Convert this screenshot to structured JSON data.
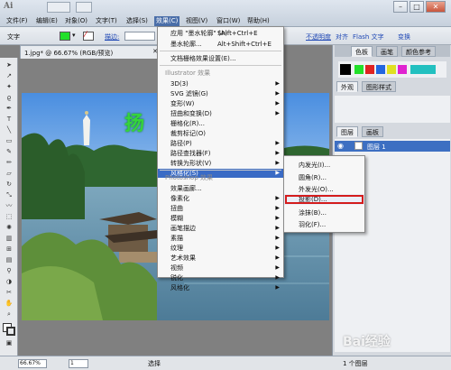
{
  "app": {
    "logo": "Ai"
  },
  "menubar": {
    "items": [
      "文件(F)",
      "编辑(E)",
      "对象(O)",
      "文字(T)",
      "选择(S)",
      "效果(C)",
      "视图(V)",
      "窗口(W)",
      "帮助(H)"
    ],
    "active_index": 5
  },
  "controlbar": {
    "label": "文字",
    "stroke_label": "描边:",
    "opacity_label": "不透明度",
    "transform_label": "变换",
    "align_label": "对齐",
    "flash_text_label": "Flash 文字",
    "fill_color": "#22e02a"
  },
  "document": {
    "tab_title": "1.jpg* @ 66.67% (RGB/预览)",
    "canvas_text": "扬"
  },
  "status": {
    "zoom": "66.67%",
    "page": "1",
    "mode": "选择",
    "selection": "1 个图层"
  },
  "panels": {
    "color_tabs": [
      "色板",
      "画笔",
      "颜色参考"
    ],
    "appearance_tabs": [
      "外观",
      "图形样式"
    ],
    "layer_tabs": [
      "图层",
      "画板"
    ],
    "layer_name": "图层 1"
  },
  "effect_menu": {
    "apply_label": "应用 \"墨水轮廓\" (A)",
    "apply_shortcut": "Shift+Ctrl+E",
    "last_label": "墨水轮廓...",
    "last_shortcut": "Alt+Shift+Ctrl+E",
    "raster_settings": "文档栅格效果设置(E)...",
    "illustrator_header": "Illustrator 效果",
    "illustrator_items": [
      {
        "label": "3D(3)",
        "arrow": true
      },
      {
        "label": "SVG 滤镜(G)",
        "arrow": true
      },
      {
        "label": "变形(W)",
        "arrow": true
      },
      {
        "label": "扭曲和变换(D)",
        "arrow": true
      },
      {
        "label": "栅格化(R)...",
        "arrow": false
      },
      {
        "label": "裁剪标记(O)",
        "arrow": false
      },
      {
        "label": "路径(P)",
        "arrow": true
      },
      {
        "label": "路径查找器(F)",
        "arrow": true
      },
      {
        "label": "转换为形状(V)",
        "arrow": true
      },
      {
        "label": "风格化(S)",
        "arrow": true
      }
    ],
    "photoshop_header": "Photoshop 效果",
    "photoshop_items": [
      {
        "label": "效果画廊...",
        "arrow": false
      },
      {
        "label": "像素化",
        "arrow": true
      },
      {
        "label": "扭曲",
        "arrow": true
      },
      {
        "label": "模糊",
        "arrow": true
      },
      {
        "label": "画笔描边",
        "arrow": true
      },
      {
        "label": "素描",
        "arrow": true
      },
      {
        "label": "纹理",
        "arrow": true
      },
      {
        "label": "艺术效果",
        "arrow": true
      },
      {
        "label": "视频",
        "arrow": true
      },
      {
        "label": "锐化",
        "arrow": true
      },
      {
        "label": "风格化",
        "arrow": true
      }
    ]
  },
  "stylize_menu": {
    "items": [
      "内发光(I)...",
      "圆角(R)...",
      "外发光(O)...",
      "投影(D)...",
      "涂抹(B)...",
      "羽化(F)..."
    ]
  },
  "watermark": "Bai经验"
}
